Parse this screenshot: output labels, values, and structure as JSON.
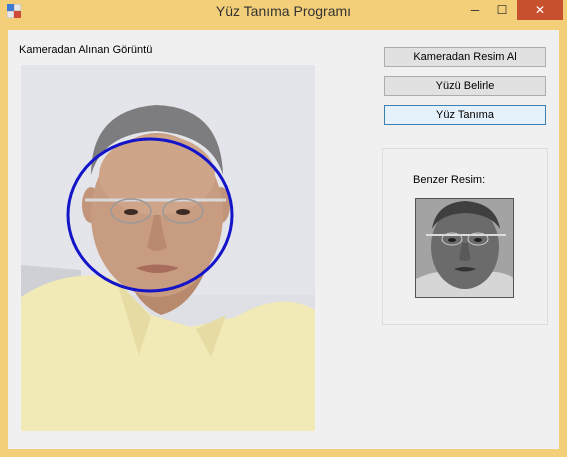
{
  "window": {
    "title": "Yüz Tanıma Programı",
    "controls": {
      "minimize": "─",
      "maximize": "☐",
      "close": "✕"
    }
  },
  "camera": {
    "label": "Kameradan Alınan Görüntü",
    "face_marker_color": "#1414c8"
  },
  "buttons": {
    "capture": "Kameradan Resim Al",
    "detect": "Yüzü Belirle",
    "recognize": "Yüz Tanıma"
  },
  "result": {
    "label": "Benzer Resim:"
  },
  "colors": {
    "title_bar": "#f3cf7a",
    "close_button": "#c7502f",
    "focus_border": "#3c7fb1"
  }
}
